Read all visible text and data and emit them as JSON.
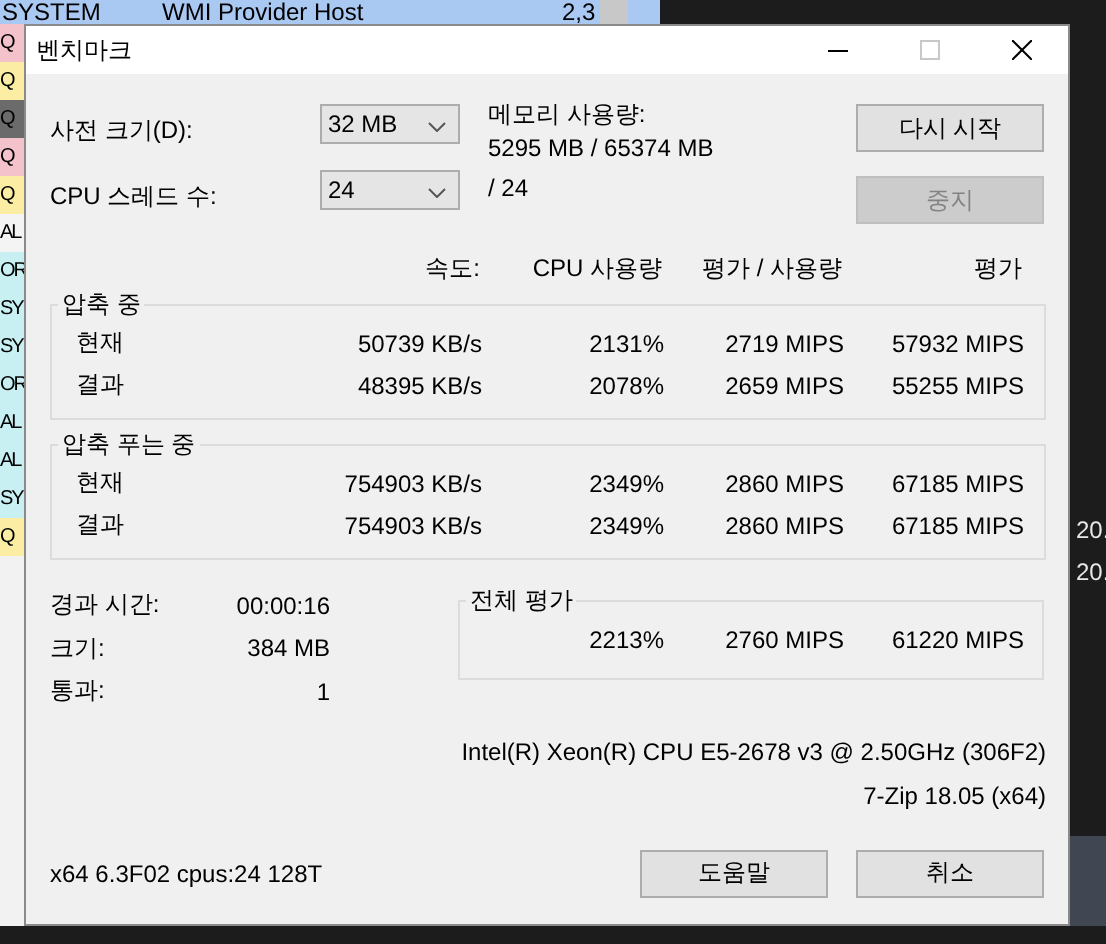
{
  "background_window": {
    "top_row": [
      "SYSTEM",
      "WMI Provider Host",
      "2,3"
    ],
    "list_items": [
      {
        "text": "Q",
        "color": "#f4c2cb"
      },
      {
        "text": "Q",
        "color": "#fbeea4"
      },
      {
        "text": "Q",
        "color": "#6b6b6b"
      },
      {
        "text": "Q",
        "color": "#f4c2cb"
      },
      {
        "text": "Q",
        "color": "#fbeea4"
      },
      {
        "text": "AL",
        "color": "#f4f4f4"
      },
      {
        "text": "OR",
        "color": "#c8eff2"
      },
      {
        "text": "SY",
        "color": "#c8eff2"
      },
      {
        "text": "SY",
        "color": "#c8eff2"
      },
      {
        "text": "OR",
        "color": "#c8eff2"
      },
      {
        "text": "AL",
        "color": "#c8eff2"
      },
      {
        "text": "AL",
        "color": "#c8eff2"
      },
      {
        "text": "SY",
        "color": "#c8eff2"
      },
      {
        "text": "Q",
        "color": "#fbeea4"
      }
    ]
  },
  "desktop_texts": [
    "20.",
    "20."
  ],
  "dialog": {
    "title": "벤치마크",
    "settings": [
      {
        "label": "사전 크기(D):",
        "value": "32 MB",
        "info": [
          "메모리 사용량:",
          "5295 MB / 65374 MB"
        ],
        "button": {
          "label": "다시 시작",
          "disabled": false
        }
      },
      {
        "label": "CPU 스레드 수:",
        "value": "24",
        "info": [
          "/ 24"
        ],
        "button": {
          "label": "중지",
          "disabled": true
        }
      }
    ],
    "columns": [
      "속도:",
      "CPU 사용량",
      "평가 / 사용량",
      "평가"
    ],
    "groups": [
      {
        "title": "압축 중",
        "rows": [
          {
            "label": "현재",
            "cells": [
              "50739 KB/s",
              "2131%",
              "2719 MIPS",
              "57932 MIPS"
            ]
          },
          {
            "label": "결과",
            "cells": [
              "48395 KB/s",
              "2078%",
              "2659 MIPS",
              "55255 MIPS"
            ]
          }
        ]
      },
      {
        "title": "압축 푸는 중",
        "rows": [
          {
            "label": "현재",
            "cells": [
              "754903 KB/s",
              "2349%",
              "2860 MIPS",
              "67185 MIPS"
            ]
          },
          {
            "label": "결과",
            "cells": [
              "754903 KB/s",
              "2349%",
              "2860 MIPS",
              "67185 MIPS"
            ]
          }
        ]
      }
    ],
    "stats": [
      {
        "label": "경과 시간:",
        "value": "00:00:16"
      },
      {
        "label": "크기:",
        "value": "384 MB"
      },
      {
        "label": "통과:",
        "value": "1"
      }
    ],
    "total": {
      "title": "전체 평가",
      "cells": [
        "2213%",
        "2760 MIPS",
        "61220 MIPS"
      ]
    },
    "cpu_info": "Intel(R) Xeon(R) CPU E5-2678 v3 @ 2.50GHz (306F2)",
    "version": "7-Zip 18.05 (x64)",
    "system_info": "x64 6.3F02 cpus:24 128T",
    "buttons": [
      {
        "label": "도움말",
        "disabled": false
      },
      {
        "label": "취소",
        "disabled": false
      }
    ]
  }
}
